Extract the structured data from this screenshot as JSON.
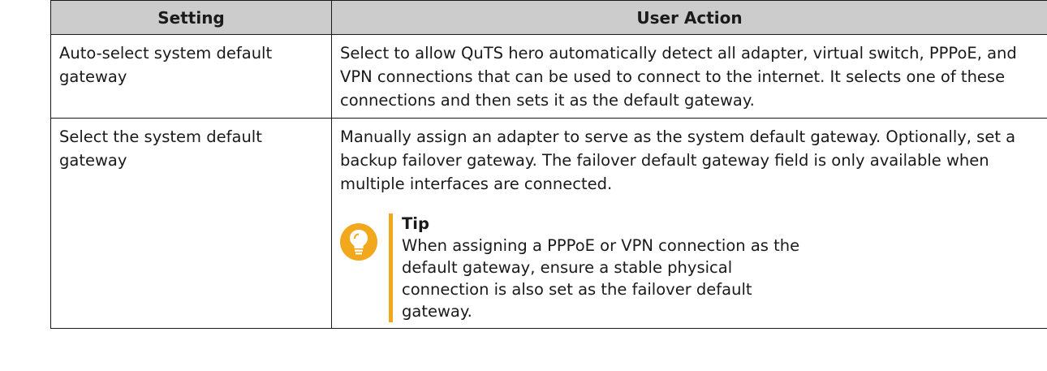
{
  "table": {
    "headers": {
      "setting": "Setting",
      "action": "User Action"
    },
    "rows": [
      {
        "setting": "Auto-select system default gateway",
        "action": "Select to allow QuTS hero automatically detect all adapter, virtual switch, PPPoE, and VPN connections that can be used to connect to the internet. It selects one of these connections and then sets it as the default gateway."
      },
      {
        "setting": "Select the system default gateway",
        "action": "Manually assign an adapter to serve as the system default gateway. Optionally, set a backup failover gateway. The failover default gateway field is only available when multiple interfaces are connected.",
        "tip": {
          "title": "Tip",
          "text": "When assigning a PPPoE or VPN connection as the default gateway, ensure a stable physical connection is also set as the failover default gateway."
        }
      }
    ]
  },
  "colors": {
    "header_bg": "#cccccc",
    "tip_accent": "#f2a81d",
    "border": "#1a1a1a"
  },
  "icons": {
    "tip": "lightbulb-icon"
  }
}
